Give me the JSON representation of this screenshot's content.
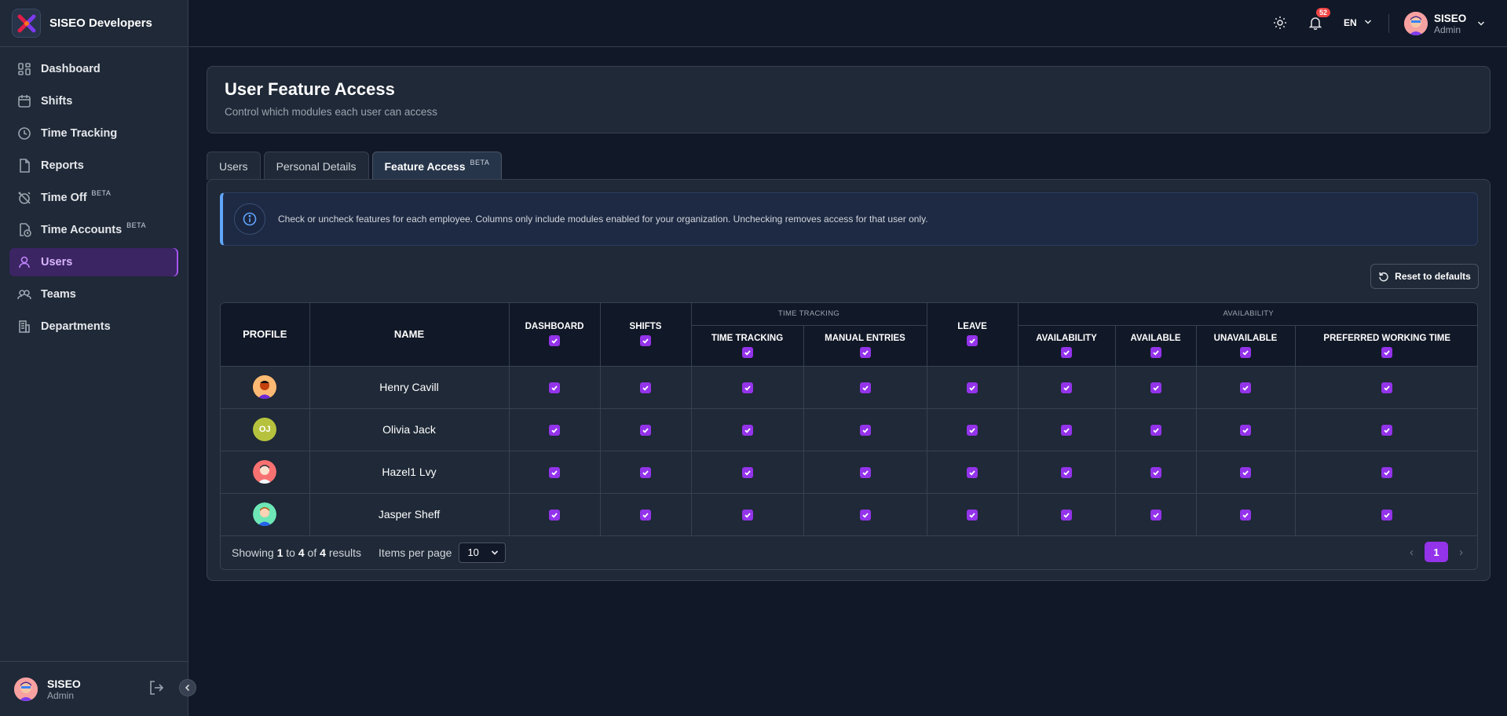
{
  "brand": {
    "name": "SISEO Developers"
  },
  "sidebar": {
    "items": [
      {
        "label": "Dashboard",
        "icon": "dashboard-icon",
        "beta": ""
      },
      {
        "label": "Shifts",
        "icon": "calendar-icon",
        "beta": ""
      },
      {
        "label": "Time Tracking",
        "icon": "clock-icon",
        "beta": ""
      },
      {
        "label": "Reports",
        "icon": "document-icon",
        "beta": ""
      },
      {
        "label": "Time Off",
        "icon": "alarm-off-icon",
        "beta": "BETA"
      },
      {
        "label": "Time Accounts",
        "icon": "timer-file-icon",
        "beta": "BETA"
      },
      {
        "label": "Users",
        "icon": "user-icon",
        "beta": ""
      },
      {
        "label": "Teams",
        "icon": "team-icon",
        "beta": ""
      },
      {
        "label": "Departments",
        "icon": "building-icon",
        "beta": ""
      }
    ],
    "active": "Users",
    "footer": {
      "name": "SISEO",
      "role": "Admin"
    }
  },
  "header": {
    "notification_count": "52",
    "language": "EN",
    "user": {
      "name": "SISEO",
      "role": "Admin"
    }
  },
  "page": {
    "title": "User Feature Access",
    "subtitle": "Control which modules each user can access"
  },
  "tabs": [
    {
      "label": "Users"
    },
    {
      "label": "Personal Details"
    },
    {
      "label": "Feature Access",
      "beta": "BETA",
      "active": true
    }
  ],
  "info": {
    "text": "Check or uncheck features for each employee. Columns only include modules enabled for your organization. Unchecking removes access for that user only."
  },
  "reset_label": "Reset to defaults",
  "table": {
    "group_headers": {
      "time_tracking": "TIME TRACKING",
      "availability": "AVAILABILITY"
    },
    "headers": {
      "profile": "PROFILE",
      "name": "NAME",
      "dashboard": "DASHBOARD",
      "shifts": "SHIFTS",
      "time_tracking": "TIME TRACKING",
      "manual_entries": "MANUAL ENTRIES",
      "leave": "LEAVE",
      "availability": "AVAILABILITY",
      "available": "AVAILABLE",
      "unavailable": "UNAVAILABLE",
      "preferred_working_time": "PREFERRED WORKING TIME"
    },
    "rows": [
      {
        "name": "Henry Cavill",
        "avatar": "avatar-illustration",
        "initials": ""
      },
      {
        "name": "Olivia Jack",
        "avatar": "initials",
        "initials": "OJ"
      },
      {
        "name": "Hazel1 Lvy",
        "avatar": "avatar-illustration",
        "initials": ""
      },
      {
        "name": "Jasper Sheff",
        "avatar": "avatar-illustration",
        "initials": ""
      }
    ],
    "all_checked": true
  },
  "footer": {
    "showing": "Showing",
    "from": "1",
    "to_word": "to",
    "to": "4",
    "of_word": "of",
    "total": "4",
    "results_word": "results",
    "items_per_page_label": "Items per page",
    "items_per_page": "10",
    "current_page": "1"
  },
  "colors": {
    "accent": "#9333ea",
    "info_border": "#60a5fa",
    "badge": "#ef4444",
    "background": "#111827",
    "panel": "#1f2937"
  }
}
